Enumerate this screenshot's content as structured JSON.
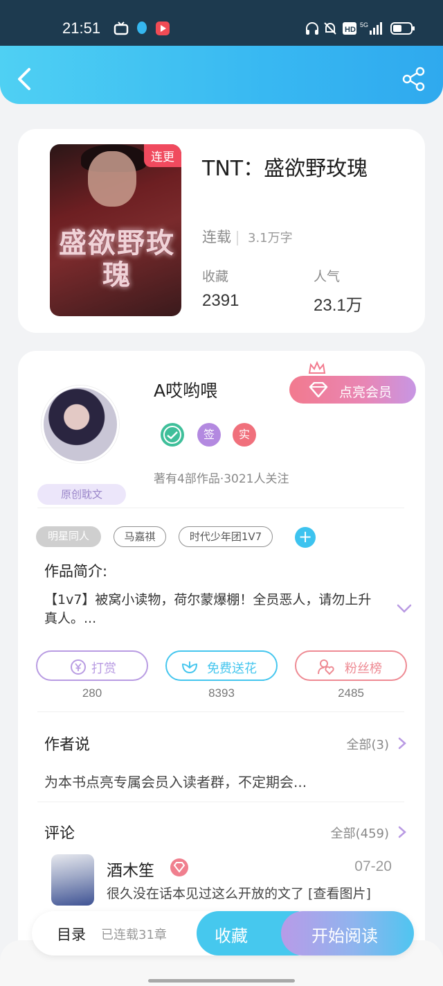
{
  "status_bar": {
    "time": "21:51"
  },
  "book": {
    "cover_tag": "连更",
    "cover_title": "盛欲野玫瑰",
    "title": "TNT：盛欲野玫瑰",
    "status": "连载",
    "word_count": "3.1万字",
    "favorites_label": "收藏",
    "favorites_value": "2391",
    "popularity_label": "人气",
    "popularity_value": "23.1万"
  },
  "author": {
    "name": "A哎哟喂",
    "vip_button": "点亮会员",
    "badge_sign": "签",
    "badge_real": "实",
    "works": "著有4部作品·3021人关注",
    "original_badge": "原创耽文"
  },
  "tags": [
    "明星同人",
    "马嘉祺",
    "时代少年团1V7"
  ],
  "add_tag": "+",
  "intro": {
    "heading": "作品简介:",
    "text": "【1v7】被窝小读物，荷尔蒙爆棚！全员恶人，请勿上升真人。..."
  },
  "actions": [
    {
      "label": "打赏",
      "count": "280",
      "color": "#b89be2"
    },
    {
      "label": "免费送花",
      "count": "8393",
      "color": "#45c6ee"
    },
    {
      "label": "粉丝榜",
      "count": "2485",
      "color": "#ee8a93"
    }
  ],
  "author_says": {
    "heading": "作者说",
    "all": "全部(3)",
    "text": "为本书点亮专属会员入读者群，不定期会..."
  },
  "comments": {
    "heading": "评论",
    "all": "全部(459)",
    "items": [
      {
        "name": "酒木笙",
        "date": "07-20",
        "text": "很久没在话本见过这么开放的文了 [查看图片]"
      }
    ]
  },
  "bottom": {
    "catalog": "目录",
    "chapters": "已连载31章",
    "favorite": "收藏",
    "read": "开始阅读"
  },
  "colors": {
    "accent": "#38b8f2",
    "vip": "#f27a8e",
    "purple": "#b89be8"
  }
}
